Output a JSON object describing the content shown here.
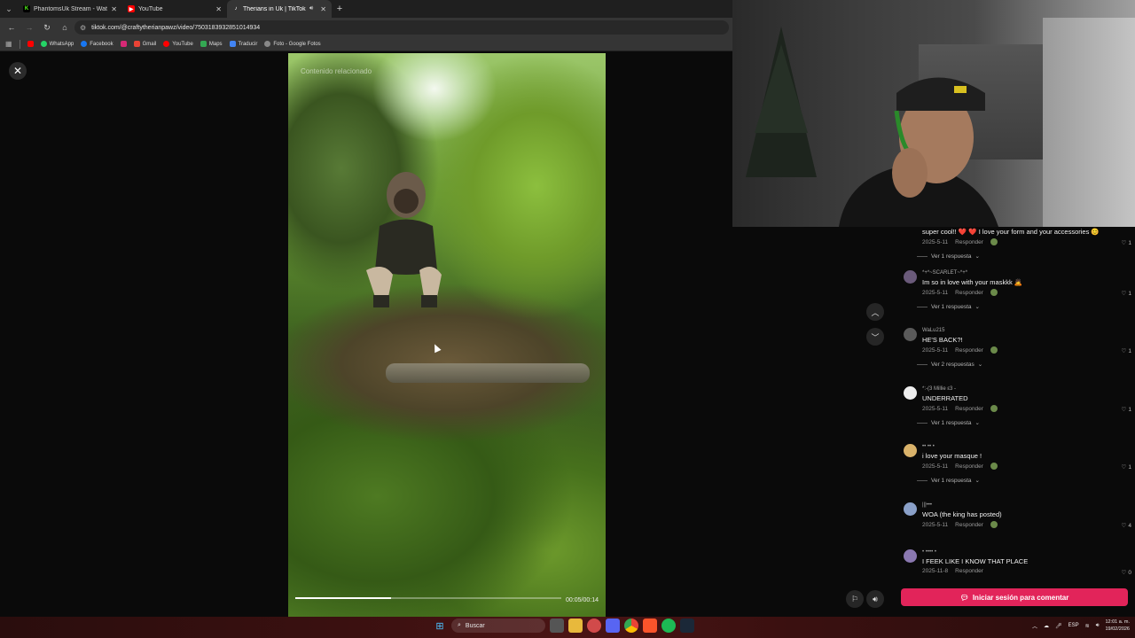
{
  "browser": {
    "tabs": [
      {
        "title": "PhantomsUk Stream - Watch Li",
        "favicon": "kick-icon",
        "color": "#53fc18"
      },
      {
        "title": "YouTube",
        "favicon": "youtube-icon",
        "color": "#ff0000"
      },
      {
        "title": "Therians in Uk | TikTok",
        "favicon": "tiktok-icon",
        "color": "#ffffff",
        "active": true
      }
    ],
    "url": "tiktok.com/@craftytherianpawz/video/7503183932851014934",
    "bookmarks": [
      {
        "label": "WhatsApp",
        "color": "#25d366"
      },
      {
        "label": "Facebook",
        "color": "#1877f2"
      },
      {
        "label": "Gmail",
        "color": "#ea4335"
      },
      {
        "label": "YouTube",
        "color": "#ff0000"
      },
      {
        "label": "Maps",
        "color": "#34a853"
      },
      {
        "label": "Traducir",
        "color": "#4285f4"
      },
      {
        "label": "Foto - Google Fotos",
        "color": "#fbbc04"
      }
    ]
  },
  "video": {
    "caption": "Contenido relacionado",
    "time": "00:05/00:14",
    "progress": 0.36
  },
  "comments": [
    {
      "user": "",
      "text": "super cool!! ❤️ ❤️ I love your form and your accessories 😊",
      "date": "2025-5-11",
      "reply": "Responder",
      "likes": "1",
      "replies": "Ver 1 respuesta",
      "avatar": "#444444"
    },
    {
      "user": "*+*~SCARLET~*+*",
      "text": "Im so in love with your maskkk 🙇",
      "date": "2025-5-11",
      "reply": "Responder",
      "likes": "1",
      "replies": "Ver 1 respuesta",
      "avatar": "#6a5a7a"
    },
    {
      "user": "WaLu215",
      "text": "HE'S BACK?!",
      "date": "2025-5-11",
      "reply": "Responder",
      "likes": "1",
      "replies": "Ver 2 respuestas",
      "avatar": "#5a5a5a"
    },
    {
      "user": "*:-(3 Millie ε3 -",
      "text": "UNDERRATED",
      "date": "2025-5-11",
      "reply": "Responder",
      "likes": "1",
      "replies": "Ver 1 respuesta",
      "avatar": "#eeeeee"
    },
    {
      "user": "•• •• •",
      "text": "i love your masque !",
      "date": "2025-5-11",
      "reply": "Responder",
      "likes": "1",
      "replies": "Ver 1 respuesta",
      "avatar": "#d9b26a"
    },
    {
      "user": "|||•••",
      "text": "WOA (the king has posted)",
      "date": "2025-5-11",
      "reply": "Responder",
      "likes": "4",
      "replies": "",
      "avatar": "#8aa0c8"
    },
    {
      "user": "• •••• •",
      "text": "I FEEK LIKE I KNOW THAT PLACE",
      "date": "2025-11-8",
      "reply": "Responder",
      "likes": "0",
      "replies": "",
      "avatar": "#8a78b0"
    }
  ],
  "login_button": "Iniciar sesión para comentar",
  "taskbar": {
    "search_placeholder": "Buscar",
    "language": "ESP",
    "time": "12:01 a. m.",
    "date": "19/02/2026"
  }
}
